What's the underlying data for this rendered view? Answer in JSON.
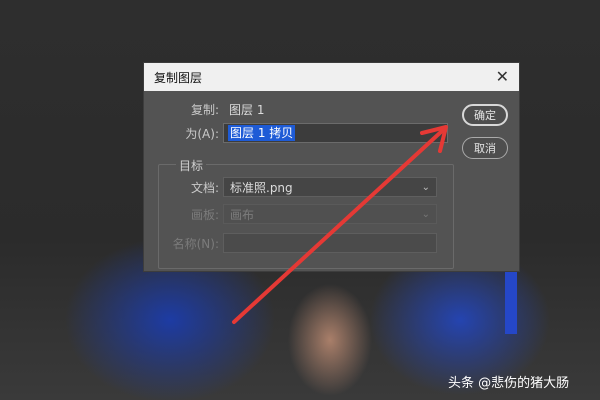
{
  "dialog": {
    "title": "复制图层",
    "close_icon": "close-icon"
  },
  "source": {
    "label": "复制:",
    "value": "图层 1"
  },
  "as": {
    "label": "为(A):",
    "value": "图层 1 拷贝"
  },
  "target": {
    "group_label": "目标",
    "document": {
      "label": "文档:",
      "value": "标准照.png"
    },
    "artboard": {
      "label": "画板:",
      "value": "画布"
    },
    "name": {
      "label": "名称(N):",
      "value": ""
    }
  },
  "buttons": {
    "ok": "确定",
    "cancel": "取消"
  },
  "annotation": {
    "color": "#e53935"
  },
  "watermark": "头条 @悲伤的猪大肠"
}
